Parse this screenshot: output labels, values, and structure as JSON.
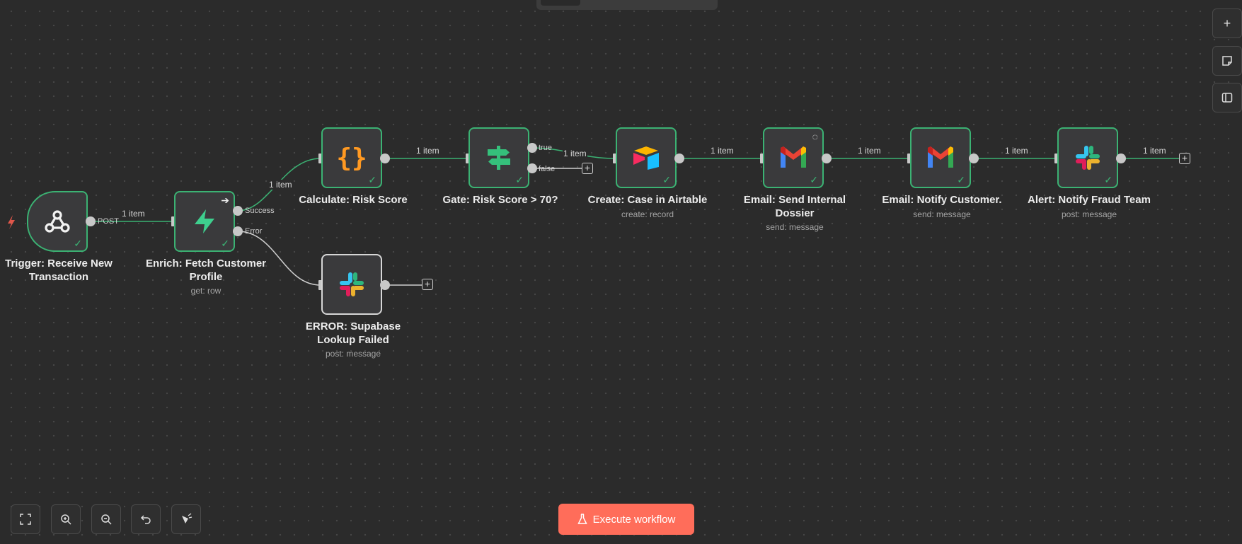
{
  "top_bar": {},
  "nodes": {
    "trigger": {
      "label": "Trigger: Receive New Transaction",
      "subtitle": "",
      "icon": "webhook-icon"
    },
    "enrich": {
      "label": "Enrich: Fetch Customer Profile",
      "subtitle": "get: row",
      "icon": "supabase-icon",
      "port_success": "Success",
      "port_error": "Error"
    },
    "calculate": {
      "label": "Calculate: Risk Score",
      "subtitle": "",
      "icon": "code-braces-icon"
    },
    "gate": {
      "label": "Gate: Risk Score > 70?",
      "subtitle": "",
      "icon": "if-signpost-icon",
      "port_true": "true",
      "port_false": "false"
    },
    "airtable": {
      "label": "Create: Case in Airtable",
      "subtitle": "create: record",
      "icon": "airtable-icon"
    },
    "email_internal": {
      "label": "Email: Send Internal Dossier",
      "subtitle": "send: message",
      "icon": "gmail-icon"
    },
    "email_customer": {
      "label": "Email: Notify Customer.",
      "subtitle": "send: message",
      "icon": "gmail-icon"
    },
    "alert": {
      "label": "Alert: Notify Fraud Team",
      "subtitle": "post: message",
      "icon": "slack-icon"
    },
    "error": {
      "label": "ERROR: Supabase Lookup Failed",
      "subtitle": "post: message",
      "icon": "slack-icon"
    }
  },
  "edges": {
    "trigger_port": "POST",
    "trigger_to_enrich": "1 item",
    "enrich_to_calculate": "1 item",
    "calculate_to_gate": "1 item",
    "gate_to_airtable": "1 item",
    "airtable_to_email_internal": "1 item",
    "email_internal_to_customer": "1 item",
    "email_customer_to_alert": "1 item",
    "alert_out": "1 item"
  },
  "right_toolbar": [
    "plus-icon",
    "sticky-note-icon",
    "panel-icon"
  ],
  "bottom_toolbar": [
    "fit-view-icon",
    "zoom-in-icon",
    "zoom-out-icon",
    "undo-icon",
    "tidy-up-icon"
  ],
  "execute_button": {
    "label": "Execute workflow",
    "icon": "flask-icon"
  },
  "colors": {
    "success": "#3bb273",
    "execute": "#ff6d5a",
    "canvas": "#2b2b2b"
  }
}
